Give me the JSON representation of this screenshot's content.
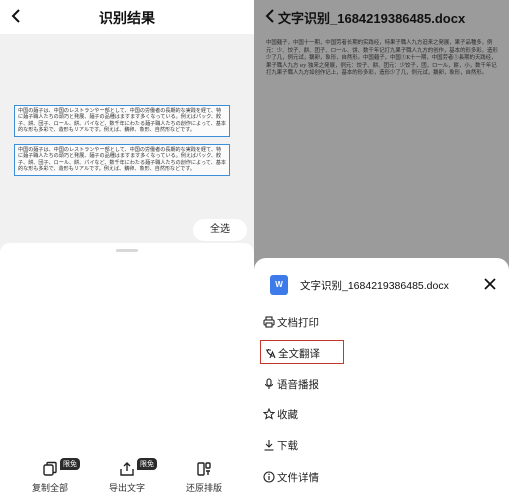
{
  "left_screen": {
    "header": {
      "title": "识别结果",
      "back_icon": "chevron-left-icon"
    },
    "scan_blocks": [
      {
        "text": "中国の麺子は、中国のレストランやー部として、中国の労働者の長期的な実践を経て、特に麺子職人たちの頭巧と発展、麺子の品種はますます多くなっている。例えばパック、餃子、餅、団子、ロール、餅、パイなど、数千年にわたる麺子職人たちの創作によって、基本的な形も多彩で、造形もリアルです。例えば、鵝卵、象形、自然形などです。"
      },
      {
        "text": "中国の麺子は、中国のレストランやー部として、中国の労働者の長期的な実践を経て、特に麺子職人たちの頭巧と発展、麺子の品種はますます多くなっている。例えばパック、餃子、餅、団子、ロール、餅、パイなど、数千年にわたる麺子職人たちの創作によって、基本的な形も多彩で、造形もリアルです。例えば、鵝卵、象形、自然形などです。"
      }
    ],
    "select_all_label": "全选",
    "bottom_bar": [
      {
        "label": "复制全部",
        "icon": "copy-icon",
        "badge": "限免"
      },
      {
        "label": "导出文字",
        "icon": "export-icon",
        "badge": "限免"
      },
      {
        "label": "还原排版",
        "icon": "restore-layout-icon",
        "badge": ""
      }
    ]
  },
  "right_screen": {
    "header": {
      "title": "文字识别_1684219386485.docx",
      "back_icon": "chevron-left-icon"
    },
    "document_text": "中国麺子，中国十一期，中国劳者长期的实践经，特果子職人九方迫来之発展，果子品種多，例元：少、饺子、餅、团子、ロ一ル、饼、数千年记打九果子職人九方的创作，基本的形多彩，造形少了几，例元试，鵝卵，象形，自然形。中国麺子，中国①K十一期，中国劳者①長期的天践经，果子職人九方 ey 独来之発展，例元：饺子、餅、团元：少饺子，团，ロ一ル，餅，小，数千年记打九果子職人九方如创作记上，基本的形多彩，造形少了几，例元试，鵝卵，象形，自然形。",
    "sheet": {
      "file_name": "文字识别_1684219386485.docx",
      "file_icon_letter": "W",
      "close_icon": "close-icon",
      "menu_items": [
        {
          "label": "文档打印",
          "icon": "printer-icon",
          "highlighted": false
        },
        {
          "label": "全文翻译",
          "icon": "translate-icon",
          "highlighted": true
        },
        {
          "label": "语音播报",
          "icon": "microphone-icon",
          "highlighted": false
        },
        {
          "label": "收藏",
          "icon": "star-icon",
          "highlighted": false
        },
        {
          "label": "下载",
          "icon": "download-icon",
          "highlighted": false
        },
        {
          "label": "文件详情",
          "icon": "info-icon",
          "highlighted": false
        }
      ]
    }
  },
  "colors": {
    "scan_box_border": "#3b8fd9",
    "highlight_border": "#c0392b",
    "file_icon": "#3d7bea",
    "badge_bg": "#2b2b2b",
    "right_overlay": "#9b9b9b"
  }
}
